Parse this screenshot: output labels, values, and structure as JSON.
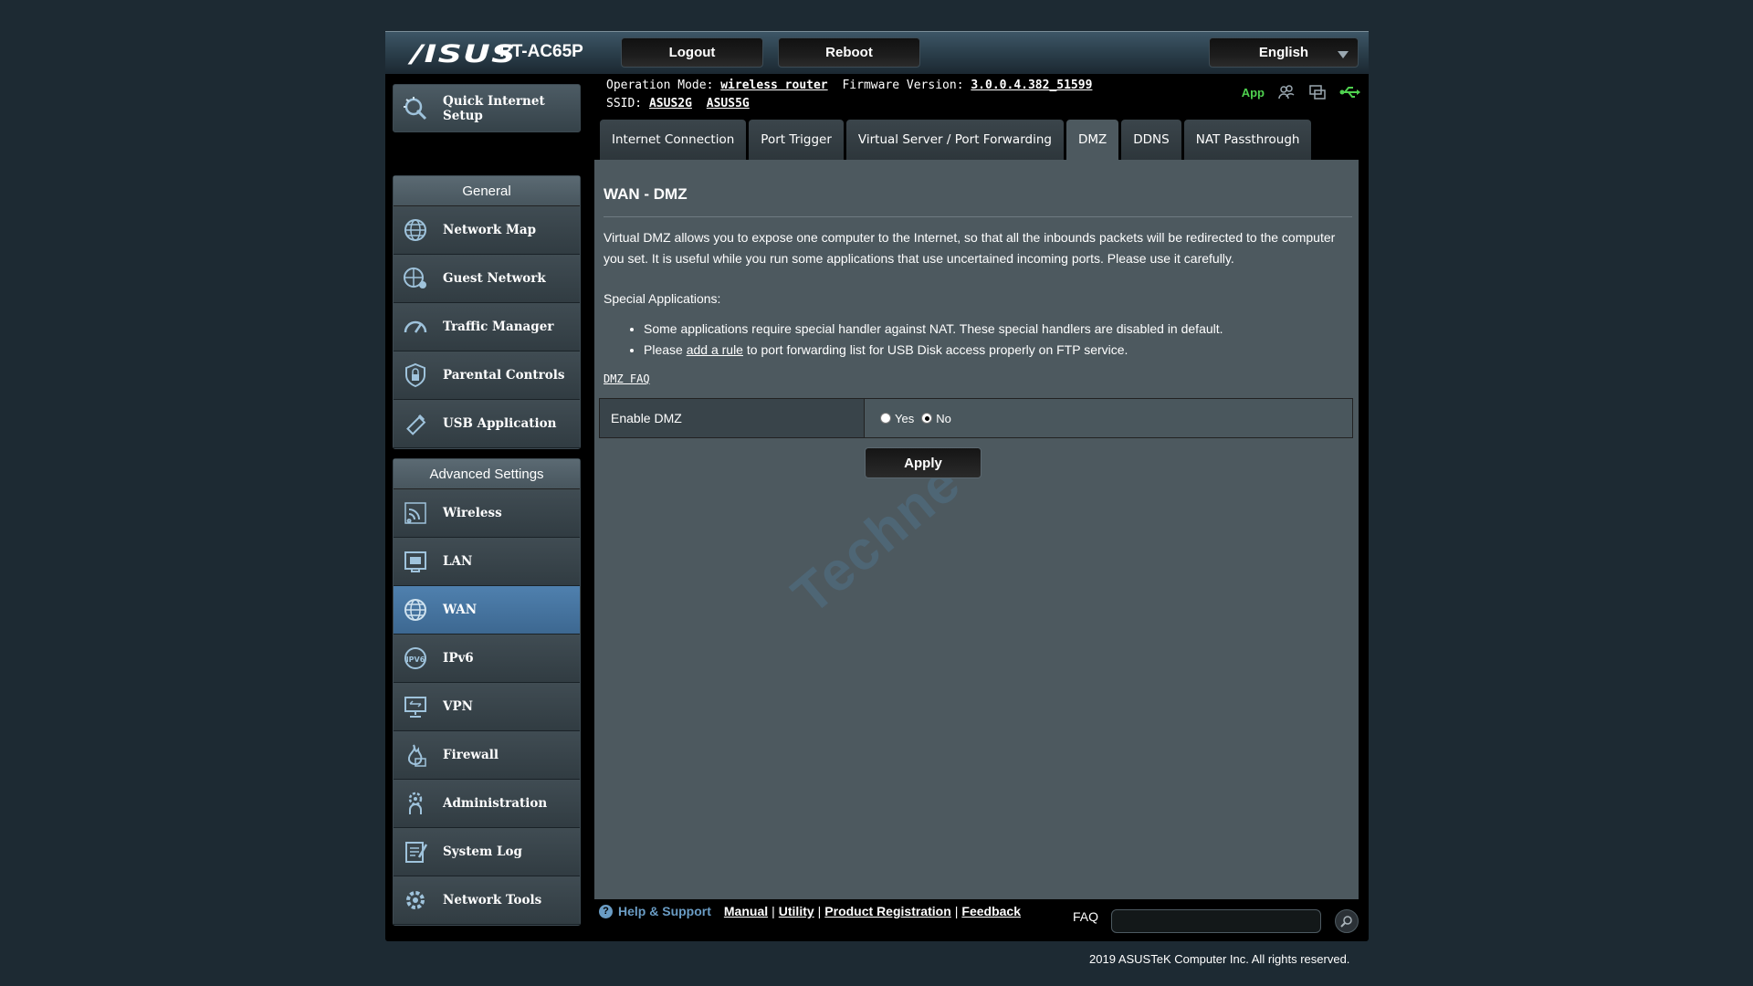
{
  "header": {
    "logo": "/ISUS",
    "model": "RT-AC65P",
    "logout_label": "Logout",
    "reboot_label": "Reboot",
    "language": "English"
  },
  "info": {
    "operation_mode_label": "Operation Mode:",
    "operation_mode_value": "wireless router",
    "firmware_label": "Firmware Version:",
    "firmware_value": "3.0.0.4.382_51599",
    "ssid_label": "SSID:",
    "ssid_1": "ASUS2G",
    "ssid_2": "ASUS5G",
    "app_label": "App"
  },
  "sidebar": {
    "quick_setup": "Quick Internet Setup",
    "general_header": "General",
    "general_items": [
      {
        "label": "Network Map",
        "icon": "globe-icon"
      },
      {
        "label": "Guest Network",
        "icon": "guest-globe-icon"
      },
      {
        "label": "Traffic Manager",
        "icon": "gauge-icon"
      },
      {
        "label": "Parental Controls",
        "icon": "lock-shield-icon"
      },
      {
        "label": "USB Application",
        "icon": "usb-icon"
      }
    ],
    "advanced_header": "Advanced Settings",
    "advanced_items": [
      {
        "label": "Wireless",
        "icon": "wifi-icon"
      },
      {
        "label": "LAN",
        "icon": "lan-icon"
      },
      {
        "label": "WAN",
        "icon": "globe-icon",
        "active": true
      },
      {
        "label": "IPv6",
        "icon": "ipv6-icon"
      },
      {
        "label": "VPN",
        "icon": "vpn-icon"
      },
      {
        "label": "Firewall",
        "icon": "flame-icon"
      },
      {
        "label": "Administration",
        "icon": "gear-person-icon"
      },
      {
        "label": "System Log",
        "icon": "log-icon"
      },
      {
        "label": "Network Tools",
        "icon": "tools-icon"
      }
    ]
  },
  "tabs": [
    {
      "label": "Internet Connection"
    },
    {
      "label": "Port Trigger"
    },
    {
      "label": "Virtual Server / Port Forwarding"
    },
    {
      "label": "DMZ",
      "active": true
    },
    {
      "label": "DDNS"
    },
    {
      "label": "NAT Passthrough"
    }
  ],
  "main": {
    "title": "WAN - DMZ",
    "description": "Virtual DMZ allows you to expose one computer to the Internet, so that all the inbounds packets will be redirected to the computer you set. It is useful while you run some applications that use uncertained incoming ports. Please use it carefully.",
    "special_title": "Special Applications:",
    "bullet_1": "Some applications require special handler against NAT. These special handlers are disabled in default.",
    "bullet_2_prefix": "Please",
    "bullet_2_link": "add a rule",
    "bullet_2_suffix": "to port forwarding list for USB Disk access properly on FTP service.",
    "faq_link": "DMZ FAQ",
    "enable_dmz_label": "Enable DMZ",
    "yes_label": "Yes",
    "no_label": "No",
    "selected": "No",
    "apply_label": "Apply",
    "watermark": "Techne"
  },
  "footer": {
    "help_label": "Help & Support",
    "manual": "Manual",
    "utility": "Utility",
    "product_registration": "Product Registration",
    "feedback": "Feedback",
    "faq_label": "FAQ",
    "faq_placeholder": "",
    "copyright": "2019 ASUSTeK Computer Inc. All rights reserved."
  }
}
